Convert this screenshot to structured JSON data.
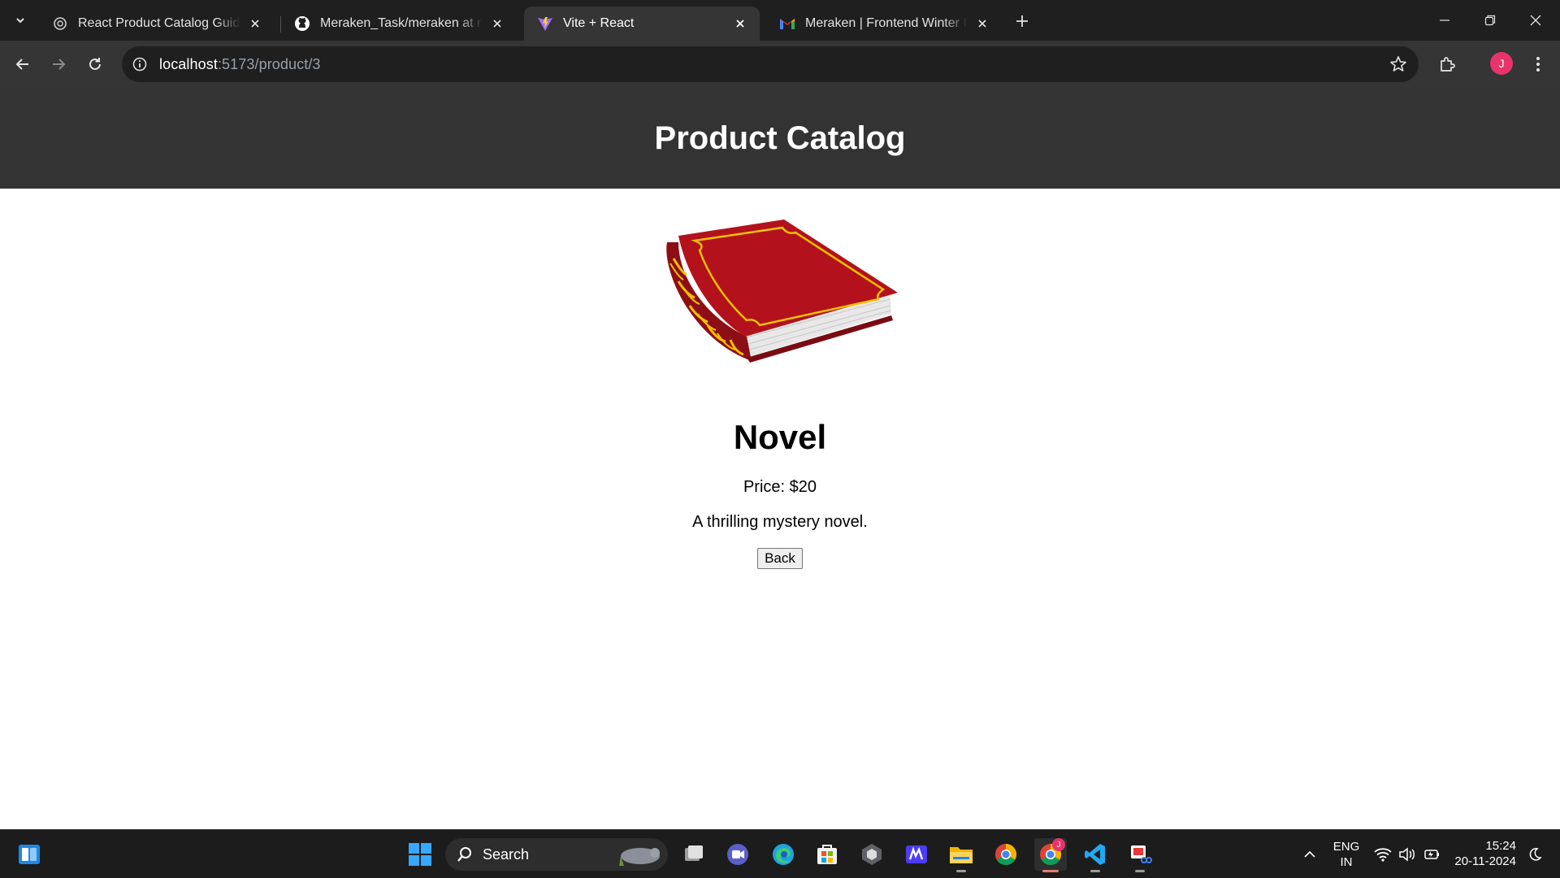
{
  "browser": {
    "tabs": [
      {
        "title": "React Product Catalog Guide",
        "icon": "openai-icon"
      },
      {
        "title": "Meraken_Task/meraken at main",
        "icon": "github-icon"
      },
      {
        "title": "Vite + React",
        "icon": "vite-icon"
      },
      {
        "title": "Meraken | Frontend Winter Inte",
        "icon": "gmail-icon"
      }
    ],
    "url_host": "localhost",
    "url_path": ":5173/product/3",
    "profile_initial": "J"
  },
  "page": {
    "header_title": "Product Catalog",
    "product": {
      "image_icon": "red-book-image",
      "name": "Novel",
      "price_text": "Price: $20",
      "description": "A thrilling mystery novel."
    },
    "back_label": "Back"
  },
  "taskbar": {
    "search_label": "Search",
    "language_line1": "ENG",
    "language_line2": "IN",
    "time": "15:24",
    "date": "20-11-2024",
    "chrome_badge": "J"
  },
  "colors": {
    "header_bg": "#333333",
    "book_red": "#b3121c",
    "book_gold": "#f2c200",
    "profile_pink": "#e8336d"
  }
}
